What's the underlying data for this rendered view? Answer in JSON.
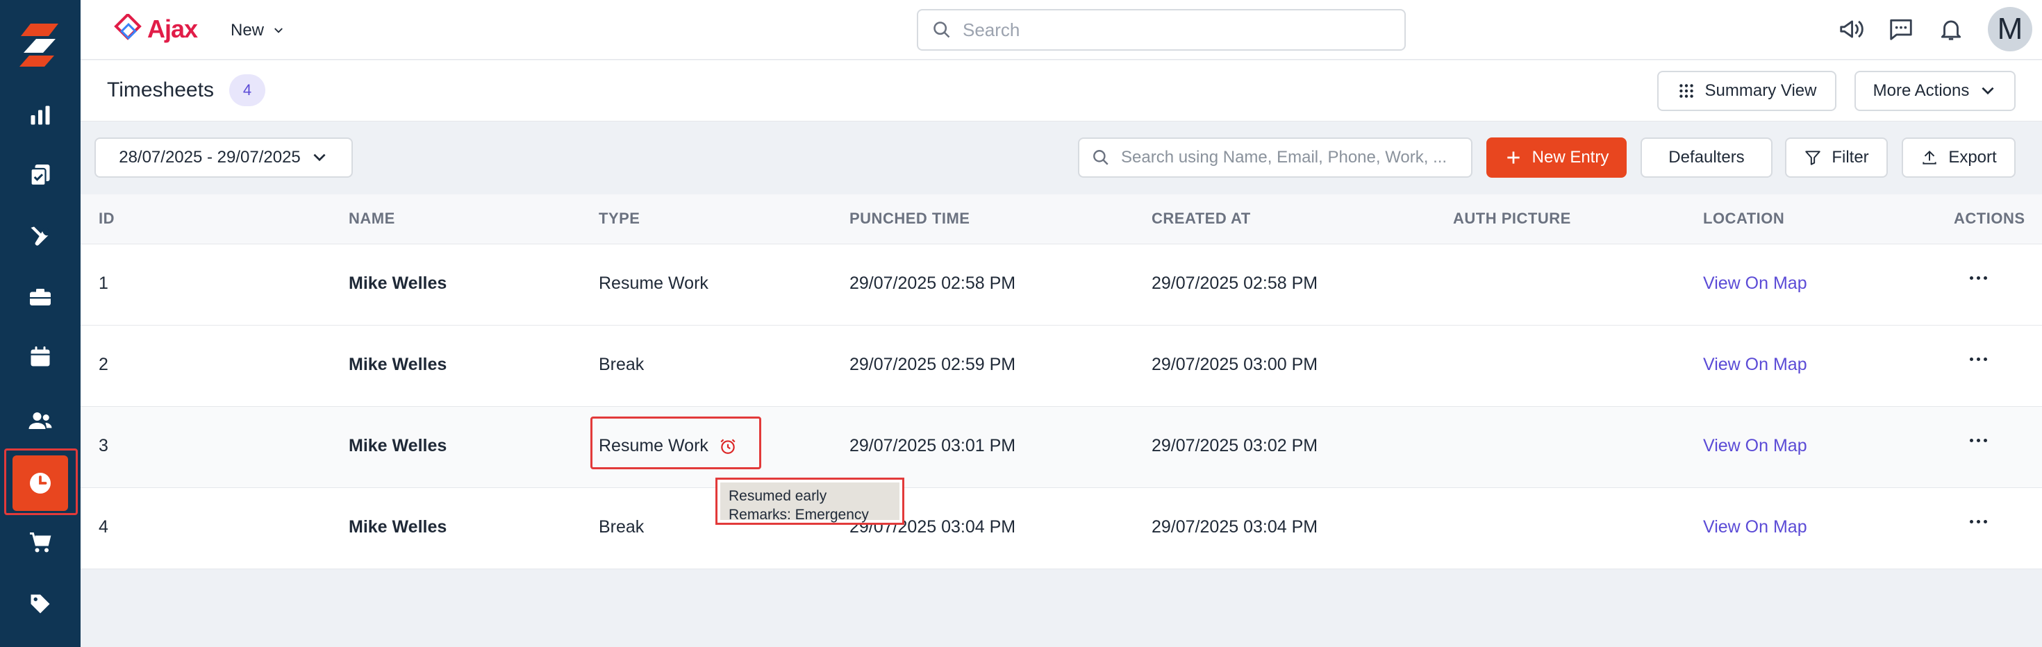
{
  "brand": {
    "name": "Ajax"
  },
  "header": {
    "new_label": "New",
    "search_placeholder": "Search",
    "avatar_initial": "M"
  },
  "page": {
    "title": "Timesheets",
    "count": "4",
    "summary_view_label": "Summary View",
    "more_actions_label": "More Actions"
  },
  "toolbar": {
    "date_range": "28/07/2025 - 29/07/2025",
    "search_placeholder": "Search using Name, Email, Phone, Work, ...",
    "new_entry_label": "New Entry",
    "defaulters_label": "Defaulters",
    "filter_label": "Filter",
    "export_label": "Export"
  },
  "table": {
    "columns": [
      "ID",
      "NAME",
      "TYPE",
      "PUNCHED TIME",
      "CREATED AT",
      "AUTH PICTURE",
      "LOCATION",
      "ACTIONS"
    ],
    "rows": [
      {
        "id": "1",
        "name": "Mike Welles",
        "type": "Resume Work",
        "punched": "29/07/2025 02:58 PM",
        "created": "29/07/2025 02:58 PM",
        "location": "View On Map"
      },
      {
        "id": "2",
        "name": "Mike Welles",
        "type": "Break",
        "punched": "29/07/2025 02:59 PM",
        "created": "29/07/2025 03:00 PM",
        "location": "View On Map"
      },
      {
        "id": "3",
        "name": "Mike Welles",
        "type": "Resume Work",
        "punched": "29/07/2025 03:01 PM",
        "created": "29/07/2025 03:02 PM",
        "location": "View On Map"
      },
      {
        "id": "4",
        "name": "Mike Welles",
        "type": "Break",
        "punched": "29/07/2025 03:04 PM",
        "created": "29/07/2025 03:04 PM",
        "location": "View On Map"
      }
    ]
  },
  "tooltip": {
    "line1": "Resumed early",
    "line2": "Remarks: Emergency"
  },
  "sidebar": {
    "items": [
      "analytics-icon",
      "tasks-icon",
      "tools-icon",
      "briefcase-icon",
      "calendar-icon",
      "users-icon",
      "clock-icon",
      "cart-icon",
      "tag-icon"
    ],
    "active": "clock-icon"
  },
  "colors": {
    "sidebar": "#0f3554",
    "accent": "#e8461f",
    "link": "#5b4bd6",
    "highlight": "#e23a3a"
  }
}
